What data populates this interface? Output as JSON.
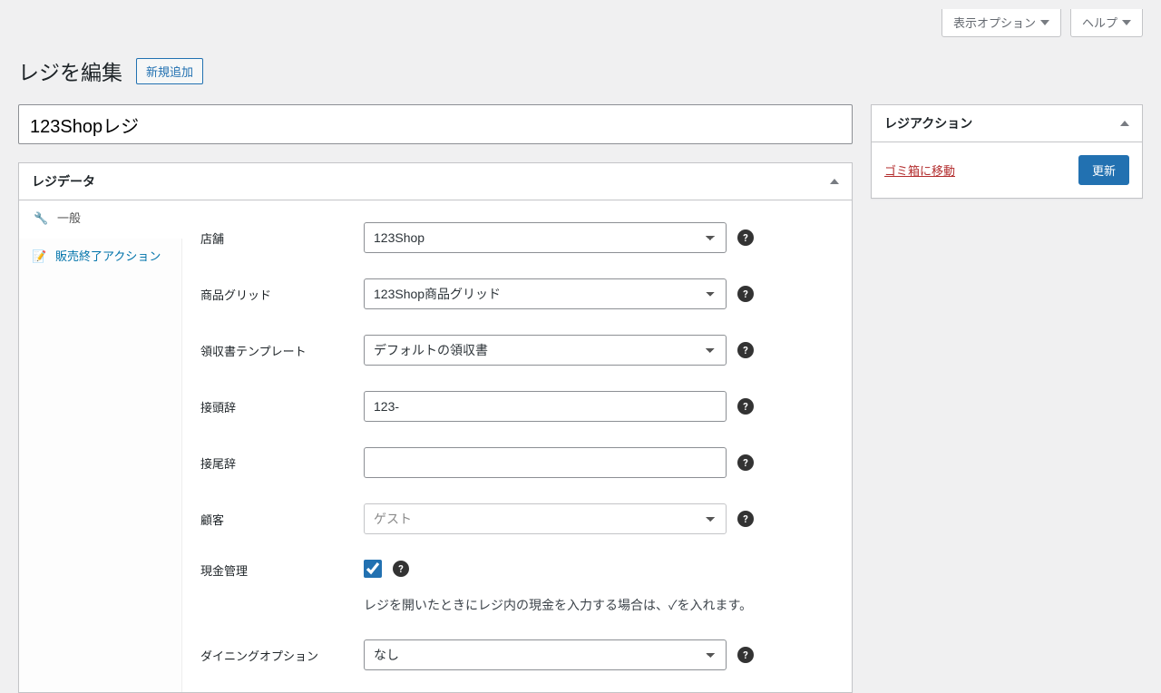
{
  "top": {
    "screen_options": "表示オプション",
    "help": "ヘルプ"
  },
  "header": {
    "title": "レジを編集",
    "add_new": "新規追加"
  },
  "title_value": "123Shopレジ",
  "register_data": {
    "box_title": "レジデータ",
    "tabs": {
      "general": "一般",
      "end_of_sale": "販売終了アクション"
    },
    "fields": {
      "outlet": {
        "label": "店舗",
        "value": "123Shop"
      },
      "product_grid": {
        "label": "商品グリッド",
        "value": "123Shop商品グリッド"
      },
      "receipt_template": {
        "label": "領収書テンプレート",
        "value": "デフォルトの領収書"
      },
      "prefix": {
        "label": "接頭辞",
        "value": "123-"
      },
      "suffix": {
        "label": "接尾辞",
        "value": ""
      },
      "customer": {
        "label": "顧客",
        "placeholder": "ゲスト"
      },
      "cash_management": {
        "label": "現金管理",
        "desc": "レジを開いたときにレジ内の現金を入力する場合は、✓を入れます。"
      },
      "dining_option": {
        "label": "ダイニングオプション",
        "value": "なし"
      }
    }
  },
  "actions": {
    "box_title": "レジアクション",
    "trash": "ゴミ箱に移動",
    "update": "更新"
  }
}
